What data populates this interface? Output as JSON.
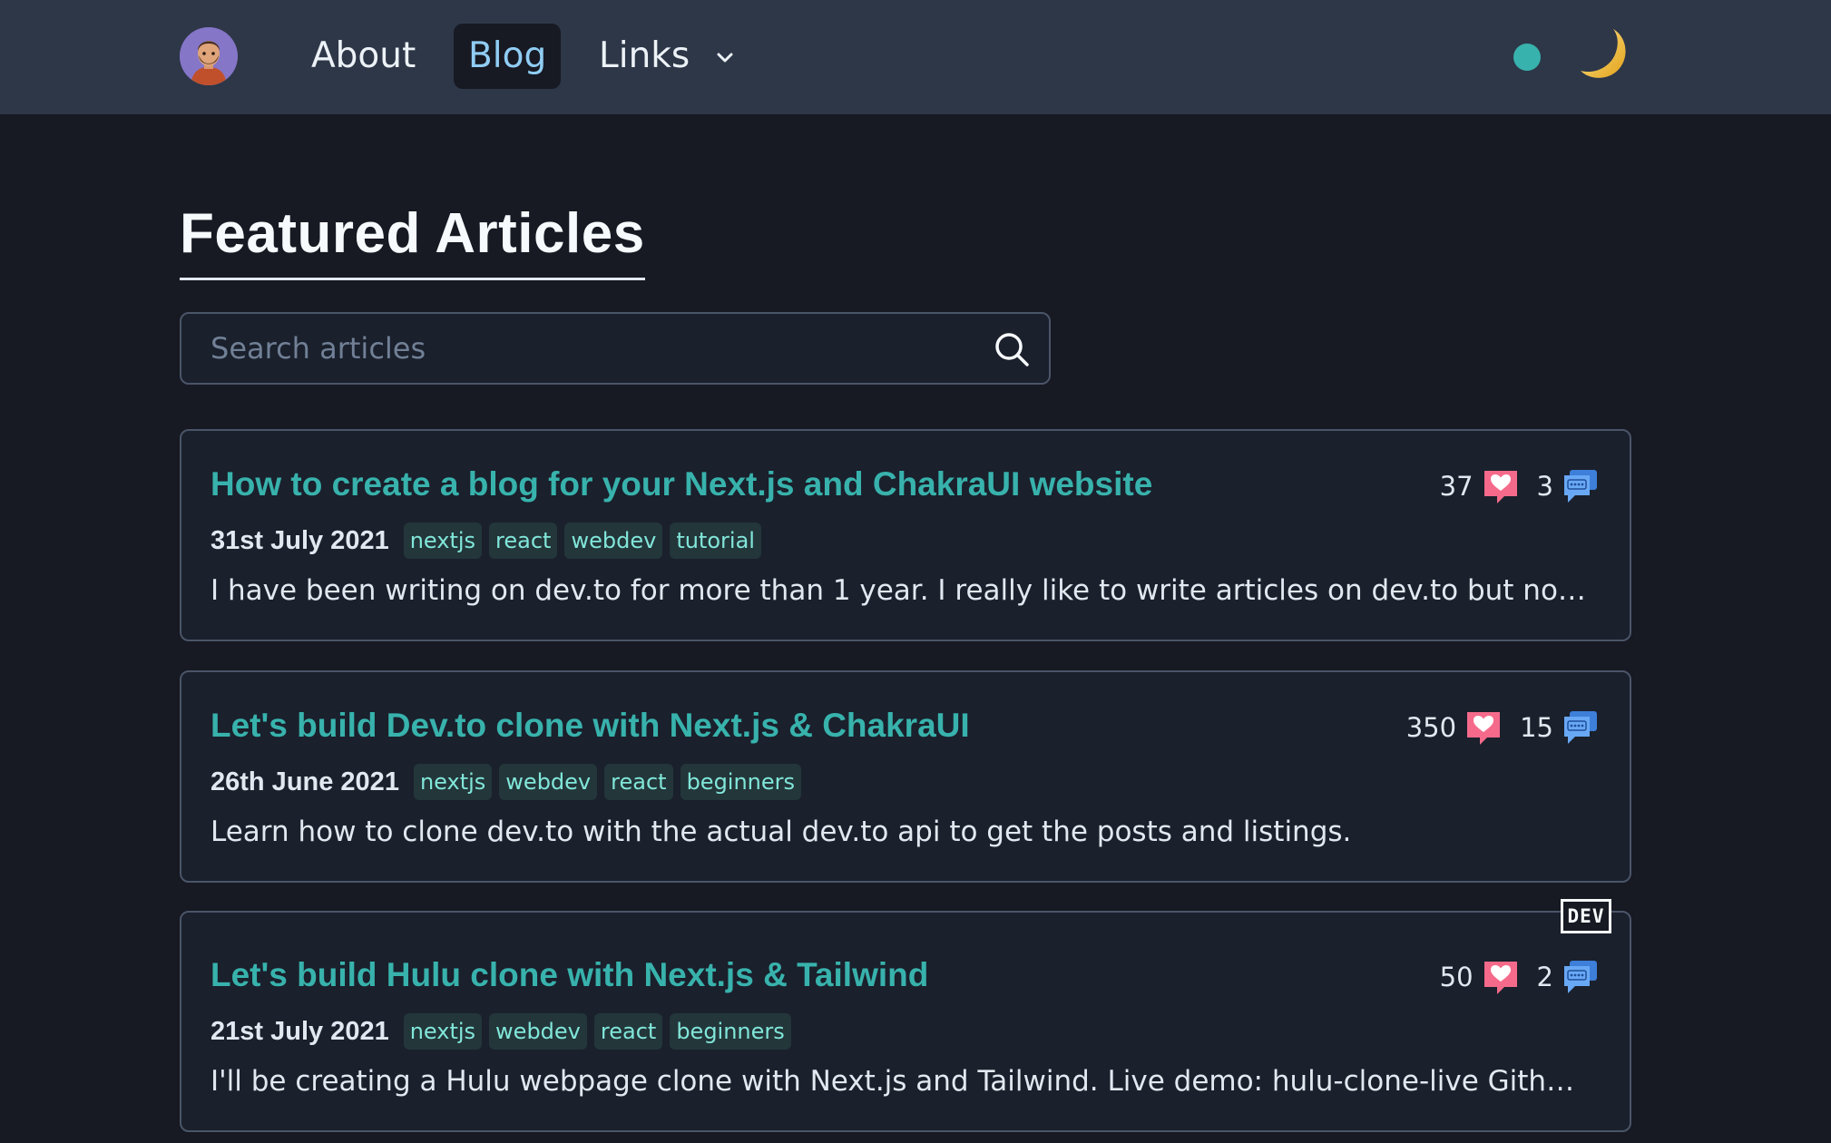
{
  "nav": {
    "about": "About",
    "blog": "Blog",
    "links": "Links"
  },
  "page": {
    "title": "Featured Articles"
  },
  "search": {
    "placeholder": "Search articles"
  },
  "articles": [
    {
      "title": "How to create a blog for your Next.js and ChakraUI website",
      "date": "31st July 2021",
      "tags": [
        "nextjs",
        "react",
        "webdev",
        "tutorial"
      ],
      "description": "I have been writing on dev.to for more than 1 year. I really like to write articles on dev.to but now I...",
      "reactions": "37",
      "comments": "3"
    },
    {
      "title": "Let's build Dev.to clone with Next.js & ChakraUI",
      "date": "26th June 2021",
      "tags": [
        "nextjs",
        "webdev",
        "react",
        "beginners"
      ],
      "description": "Learn how to clone dev.to with the actual dev.to api to get the posts and listings.",
      "reactions": "350",
      "comments": "15"
    },
    {
      "title": "Let's build Hulu clone with Next.js & Tailwind",
      "date": "21st July 2021",
      "tags": [
        "nextjs",
        "webdev",
        "react",
        "beginners"
      ],
      "description": "I'll be creating a Hulu webpage clone with Next.js and Tailwind. Live demo: hulu-clone-live Github...",
      "reactions": "50",
      "comments": "2"
    }
  ],
  "dev_badge": "DEV",
  "colors": {
    "accent": "#38b2ac",
    "nav_bg": "#2d3748",
    "page_bg": "#171923",
    "active_link": "#90cdf4",
    "heart": "#f56a8a",
    "comment": "#5b9bf0"
  },
  "icons": {
    "avatar": "avatar",
    "theme_toggle": "moon-icon",
    "search": "search-icon",
    "reactions": "heart-icon",
    "comments": "comment-icon",
    "links_dropdown": "chevron-down-icon"
  }
}
